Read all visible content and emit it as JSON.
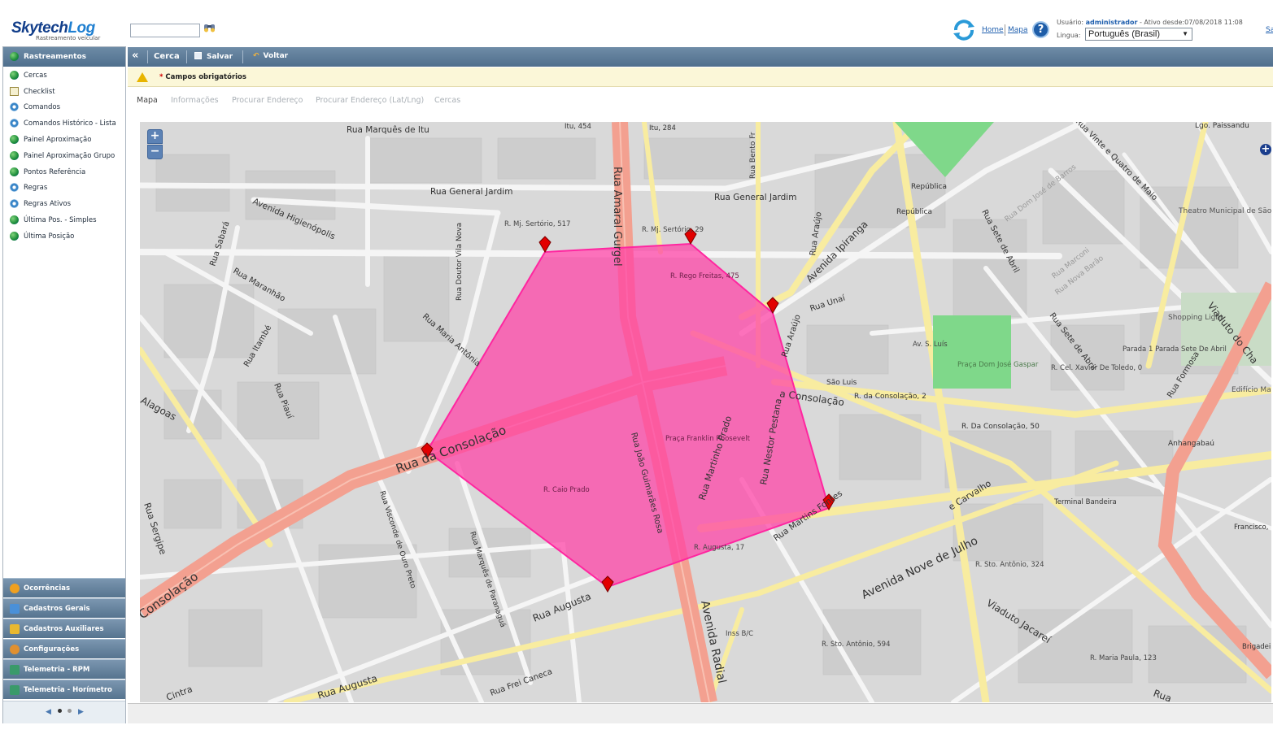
{
  "header": {
    "logo_main": "Skytech",
    "logo_log": "Log",
    "logo_sub": "Rastreamento veicular",
    "search_value": "",
    "links": {
      "home": "Home",
      "mapa": "Mapa",
      "sair": "Sa"
    },
    "user_label": "Usuário:",
    "user_name": "administrador",
    "active_since": "- Ativo desde:07/08/2018 11:08",
    "language_label": "Lingua:",
    "language_value": "Português (Brasil)"
  },
  "sidebar": {
    "section_title": "Rastreamentos",
    "items": [
      {
        "label": "Cercas",
        "icon": "globe-icon"
      },
      {
        "label": "Checklist",
        "icon": "checklist-icon"
      },
      {
        "label": "Comandos",
        "icon": "gear-icon"
      },
      {
        "label": "Comandos Histórico - Lista",
        "icon": "gear-icon"
      },
      {
        "label": "Painel Aproximação",
        "icon": "globe-icon"
      },
      {
        "label": "Painel Aproximação Grupo",
        "icon": "globe-icon"
      },
      {
        "label": "Pontos Referência",
        "icon": "globe-icon"
      },
      {
        "label": "Regras",
        "icon": "gear-icon"
      },
      {
        "label": "Regras Ativos",
        "icon": "gear-icon"
      },
      {
        "label": "Última Pos. - Simples",
        "icon": "globe-icon"
      },
      {
        "label": "Última Posição",
        "icon": "globe-icon"
      }
    ],
    "sections": [
      {
        "label": "Ocorrências",
        "color": "#f0a020"
      },
      {
        "label": "Cadastros Gerais",
        "color": "#4a90d8"
      },
      {
        "label": "Cadastros Auxiliares",
        "color": "#e8b830"
      },
      {
        "label": "Configurações",
        "color": "#e09030"
      },
      {
        "label": "Telemetria - RPM",
        "color": "#3a9a6a"
      },
      {
        "label": "Telemetria - Horímetro",
        "color": "#3a9a6a"
      }
    ]
  },
  "toolbar": {
    "title": "Cerca",
    "save": "Salvar",
    "back": "Voltar"
  },
  "warning": {
    "star": "*",
    "text": "Campos obrigatórios"
  },
  "tabs": [
    "Mapa",
    "Informações",
    "Procurar Endereço",
    "Procurar Endereço (Lat/Lng)",
    "Cercas"
  ],
  "map": {
    "zoom_in": "+",
    "zoom_out": "−",
    "fence_color": "#ff3ea5",
    "labels": {
      "marques_itu": "Rua Marquês de Itu",
      "itu_454": "Itu, 454",
      "itu_284": "Itu, 284",
      "amaral_gurgel": "Rua Amaral Gurgel",
      "bento_fr": "Rua Bento Fr",
      "general_jardim_1": "Rua General Jardim",
      "general_jardim_2": "Rua General Jardim",
      "higienopolis": "Avenida Higienópolis",
      "sabara": "Rua Sabará",
      "maranhao": "Rua Maranhão",
      "doutor_vila_nova": "Rua Doutor Vila Nova",
      "maria_antonia": "Rua Maria Antônia",
      "itambe": "Rua Itambé",
      "piaui": "Rua Piauí",
      "alagoas": "Alagoas",
      "consolacao_main": "Rua da Consolação",
      "consolacao_sw": "Consolação",
      "sergipe": "Rua Sergipe",
      "visconde": "Rua Visconde de Ouro Preto",
      "marques_paranagua": "Rua Marquês de Paranaguá",
      "augusta_1": "Rua Augusta",
      "augusta_2": "Rua Augusta",
      "frei_caneca": "Rua Frei Caneca",
      "cintra": "Cintra",
      "mj_sertorio_517": "R. Mj. Sertório, 517",
      "mj_sertorio_29": "R. Mj. Sertório, 29",
      "rego_freitas": "R. Rego Freitas, 475",
      "araujo_1": "Rua Araújo",
      "araujo_2": "Rua Araújo",
      "unai": "Rua Unaí",
      "ipiranga": "Avenida Ipiranga",
      "caio_prado": "R. Caio Prado",
      "praca_roosevelt": "Praça Franklin Roosevelt",
      "joao_guimaraes": "Rua João Guimarães Rosa",
      "martinho_prado": "Rua Martinho Prado",
      "nestor_pestana": "Rua Nestor Pestana",
      "augusta_17": "R. Augusta, 17",
      "martins_fontes": "Rua Martins Fontes",
      "radial": "Avenida Radial",
      "nove_julho": "Avenida Nove de Julho",
      "viaduto_jacarei": "Viaduto Jacareí",
      "inss": "Inss B/C",
      "sto_antonio_594": "R. Sto. Antônio, 594",
      "sto_antonio_324": "R. Sto. Antônio, 324",
      "carvalho": "e Carvalho",
      "consolacao_e": "a Consolação",
      "sao_luis": "São Luis",
      "consolacao_2": "R. da Consolação, 2",
      "consolacao_50": "R. Da Consolação, 50",
      "av_sao_luis": "Av. S. Luís",
      "praca_dom_jose": "Praça Dom José Gaspar",
      "republica_1": "República",
      "republica_2": "República",
      "vinte_quatro": "Rua Vinte e Quatro de Maio",
      "dom_jose_barros": "Rua Dom José de Barros",
      "sete_abril_1": "Rua Sete de Abril",
      "sete_abril_2": "Rua Sete de Abril",
      "marconi": "Rua Marconi",
      "nova_barao": "Rua Nova Barão",
      "cel_xavier": "R. Cel. Xavier De Toledo, 0",
      "parada_sete": "Parada 1 Parada Sete De Abril",
      "shopping_light": "Shopping Light",
      "teatro": "Theatro Municipal de São Paulo",
      "paissandu": "Lgo. Paissandu",
      "viaduto_cha": "Viaduto do Cha",
      "formosa": "Rua Formosa",
      "edificio": "Edifício Matarazzo",
      "anhangabau": "Anhangabaú",
      "terminal_bandeira": "Terminal Bandeira",
      "francisco": "Francisco,",
      "brigadeiro": "Brigadei",
      "maria_paula": "R. Maria Paula, 123",
      "rua_bottom": "Rua"
    }
  }
}
